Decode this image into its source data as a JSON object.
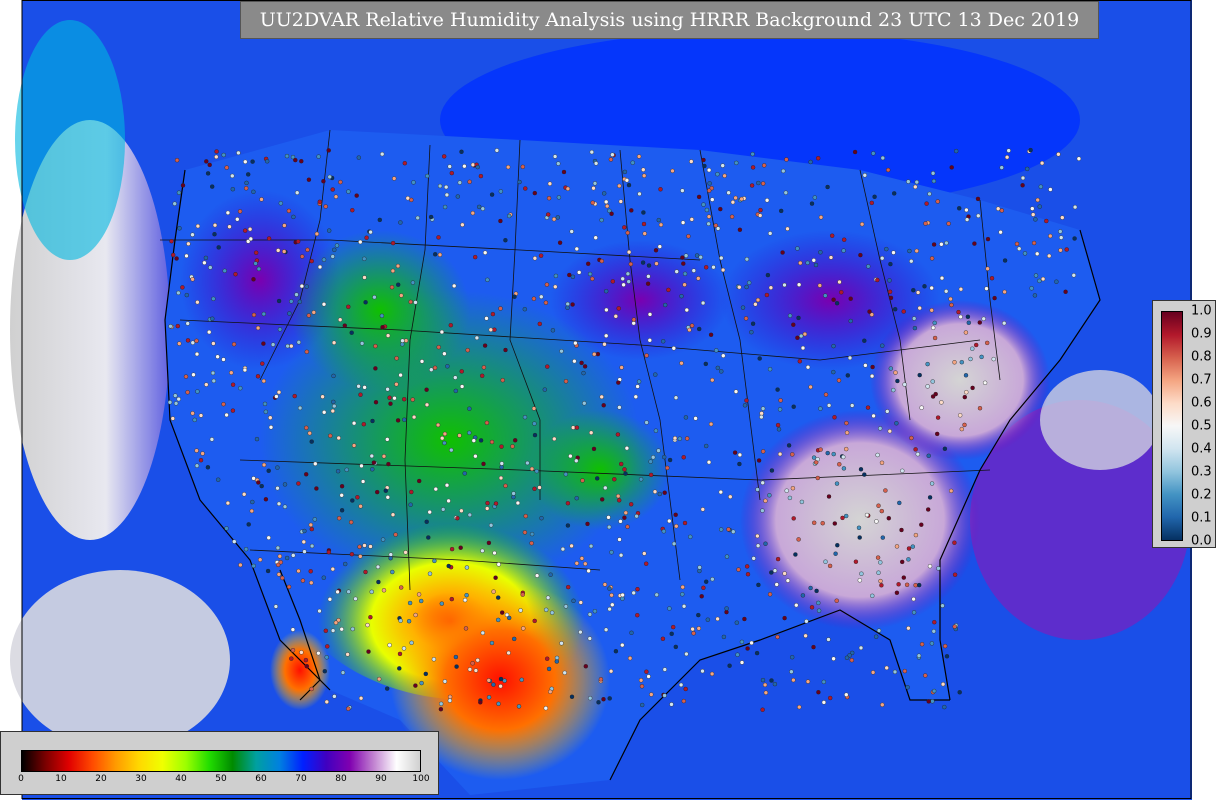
{
  "title": "UU2DVAR Relative Humidity Analysis using HRRR Background 23 UTC 13 Dec 2019",
  "rh_colorbar": {
    "ticks": [
      "0",
      "10",
      "20",
      "30",
      "40",
      "50",
      "60",
      "70",
      "80",
      "90",
      "100"
    ],
    "colors": [
      "#000000",
      "#7a0000",
      "#e00000",
      "#ff4a00",
      "#ff9a00",
      "#ffd800",
      "#f0ff00",
      "#9cff00",
      "#22dd00",
      "#008a00",
      "#00a0a0",
      "#0080e0",
      "#0020ff",
      "#4000c0",
      "#8000b0",
      "#c080d0",
      "#ffffff",
      "#d0d0d0"
    ]
  },
  "obs_colorbar": {
    "ticks": [
      "1.0",
      "0.9",
      "0.8",
      "0.7",
      "0.6",
      "0.5",
      "0.4",
      "0.3",
      "0.2",
      "0.1",
      "0.0"
    ],
    "colors": [
      "#67001f",
      "#b2182b",
      "#d6604d",
      "#f4a582",
      "#fddbc7",
      "#f7f7f7",
      "#d1e5f0",
      "#92c5de",
      "#4393c3",
      "#2166ac",
      "#053061"
    ]
  },
  "map": {
    "ocean_color": "#1a4fe8",
    "land_gray": "#cfcfcf"
  }
}
